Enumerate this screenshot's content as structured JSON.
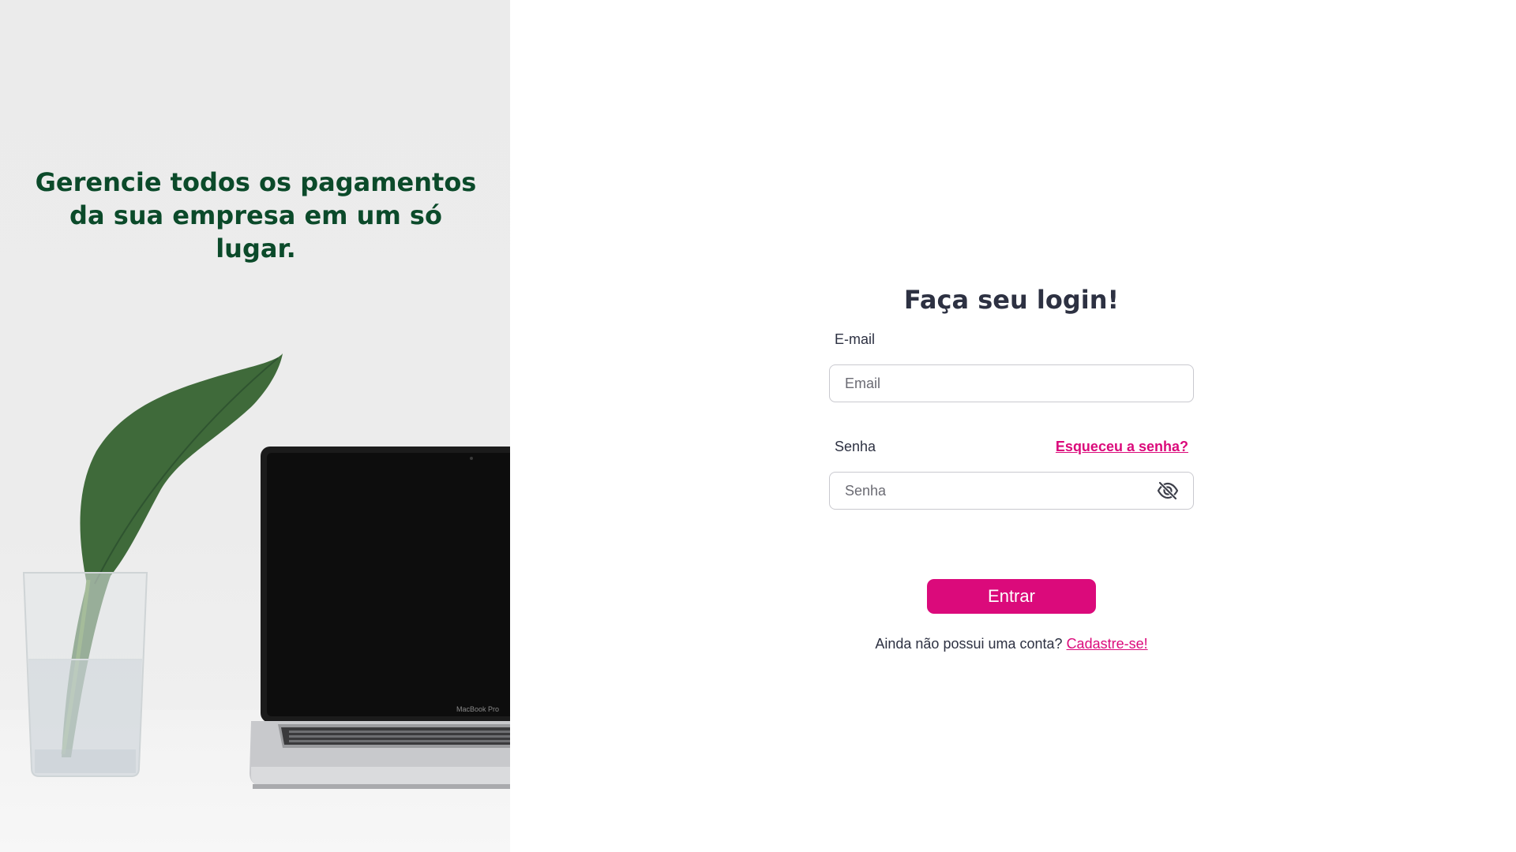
{
  "hero": {
    "heading": "Gerencie todos os pagamentos da sua empresa em um só lugar.",
    "laptop_badge": "MacBook Pro",
    "heading_color": "#0b4a2a"
  },
  "login": {
    "title": "Faça seu login!",
    "email_label": "E-mail",
    "email_placeholder": "Email",
    "email_value": "",
    "password_label": "Senha",
    "password_placeholder": "Senha",
    "password_value": "",
    "forgot_link": "Esqueceu a senha?",
    "visibility_icon": "eye-off-icon",
    "submit_label": "Entrar",
    "signup_prompt": "Ainda não possui uma conta?",
    "signup_link": "Cadastre-se!"
  },
  "colors": {
    "accent": "#db0a7b",
    "text": "#2d3142",
    "border": "#c9c9cf"
  }
}
